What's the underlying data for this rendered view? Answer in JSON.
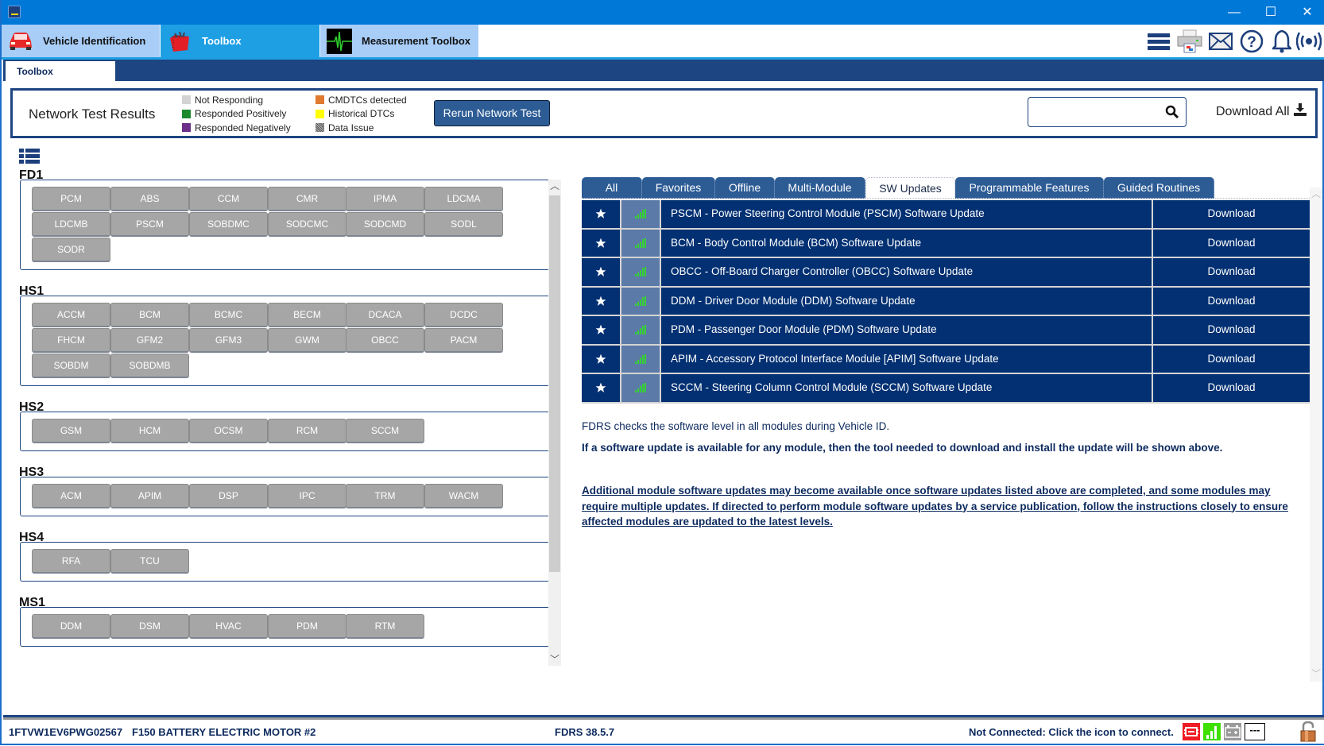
{
  "window": {
    "controls": {
      "minimize": "—",
      "maximize": "☐",
      "close": "✕"
    }
  },
  "main_tabs": [
    {
      "label": "Vehicle Identification",
      "icon": "car-icon",
      "active": false
    },
    {
      "label": "Toolbox",
      "icon": "toolbox-icon",
      "active": true
    },
    {
      "label": "Measurement Toolbox",
      "icon": "oscilloscope-icon",
      "active": false
    }
  ],
  "toolbar_icons": [
    "menu-icon",
    "printer-icon",
    "mail-icon",
    "help-icon",
    "bell-icon",
    "wireless-icon"
  ],
  "sub_tab": {
    "label": "Toolbox"
  },
  "network_test": {
    "title": "Network Test Results",
    "legend": [
      {
        "label": "Not Responding",
        "color": "#d3d3d3"
      },
      {
        "label": "Responded Positively",
        "color": "#1e8a2e"
      },
      {
        "label": "Responded Negatively",
        "color": "#6b2f8a"
      },
      {
        "label": "CMDTCs detected",
        "color": "#e07a2e"
      },
      {
        "label": "Historical DTCs",
        "color": "#ffff00"
      },
      {
        "label": "Data Issue",
        "color": "#777777"
      }
    ],
    "rerun_label": "Rerun Network Test",
    "search": {
      "value": "",
      "placeholder": ""
    },
    "download_all_label": "Download All"
  },
  "networks": [
    {
      "name": "FD1",
      "modules": [
        "PCM",
        "ABS",
        "CCM",
        "CMR",
        "IPMA",
        "LDCMA",
        "LDCMB",
        "PSCM",
        "SOBDMC",
        "SODCMC",
        "SODCMD",
        "SODL",
        "SODR"
      ]
    },
    {
      "name": "HS1",
      "modules": [
        "ACCM",
        "BCM",
        "BCMC",
        "BECM",
        "DCACA",
        "DCDC",
        "FHCM",
        "GFM2",
        "GFM3",
        "GWM",
        "OBCC",
        "PACM",
        "SOBDM",
        "SOBDMB"
      ]
    },
    {
      "name": "HS2",
      "modules": [
        "GSM",
        "HCM",
        "OCSM",
        "RCM",
        "SCCM"
      ]
    },
    {
      "name": "HS3",
      "modules": [
        "ACM",
        "APIM",
        "DSP",
        "IPC",
        "TRM",
        "WACM"
      ]
    },
    {
      "name": "HS4",
      "modules": [
        "RFA",
        "TCU"
      ]
    },
    {
      "name": "MS1",
      "modules": [
        "DDM",
        "DSM",
        "HVAC",
        "PDM",
        "RTM"
      ]
    }
  ],
  "filter_tabs": [
    {
      "label": "All",
      "active": false
    },
    {
      "label": "Favorites",
      "active": false
    },
    {
      "label": "Offline",
      "active": false
    },
    {
      "label": "Multi-Module",
      "active": false
    },
    {
      "label": "SW Updates",
      "active": true
    },
    {
      "label": "Programmable Features",
      "active": false
    },
    {
      "label": "Guided Routines",
      "active": false
    }
  ],
  "sw_updates": [
    {
      "description": "PSCM - Power Steering Control Module (PSCM) Software Update",
      "action": "Download"
    },
    {
      "description": "BCM - Body Control Module (BCM) Software Update",
      "action": "Download"
    },
    {
      "description": "OBCC - Off-Board Charger Controller (OBCC) Software Update",
      "action": "Download"
    },
    {
      "description": "DDM - Driver Door Module (DDM) Software Update",
      "action": "Download"
    },
    {
      "description": "PDM - Passenger Door Module (PDM) Software Update",
      "action": "Download"
    },
    {
      "description": "APIM - Accessory Protocol Interface Module [APIM] Software Update",
      "action": "Download"
    },
    {
      "description": "SCCM - Steering Column Control Module (SCCM) Software Update",
      "action": "Download"
    }
  ],
  "info": {
    "line1": "FDRS checks the software level in all modules during Vehicle ID.",
    "line2": "If a software update is available for any module, then the tool needed to download and install the update will be shown above.",
    "link": "Additional module software updates may become available once software updates listed above are completed, and some modules may require multiple updates. If directed to perform module software updates by a service publication, follow the instructions closely to ensure affected modules are updated to the latest levels."
  },
  "status_bar": {
    "vin": "1FTVW1EV6PWG02567",
    "vehicle": "F150 BATTERY ELECTRIC MOTOR #2",
    "version": "FDRS 38.5.7",
    "connection": "Not Connected: Click the icon to connect.",
    "indicator_text": "---"
  },
  "colors": {
    "accent": "#1d4582",
    "row_bg": "#023072",
    "tab_bg": "#2d5c95",
    "module_btn": "#a6a6a6",
    "signal": "#35d232"
  }
}
